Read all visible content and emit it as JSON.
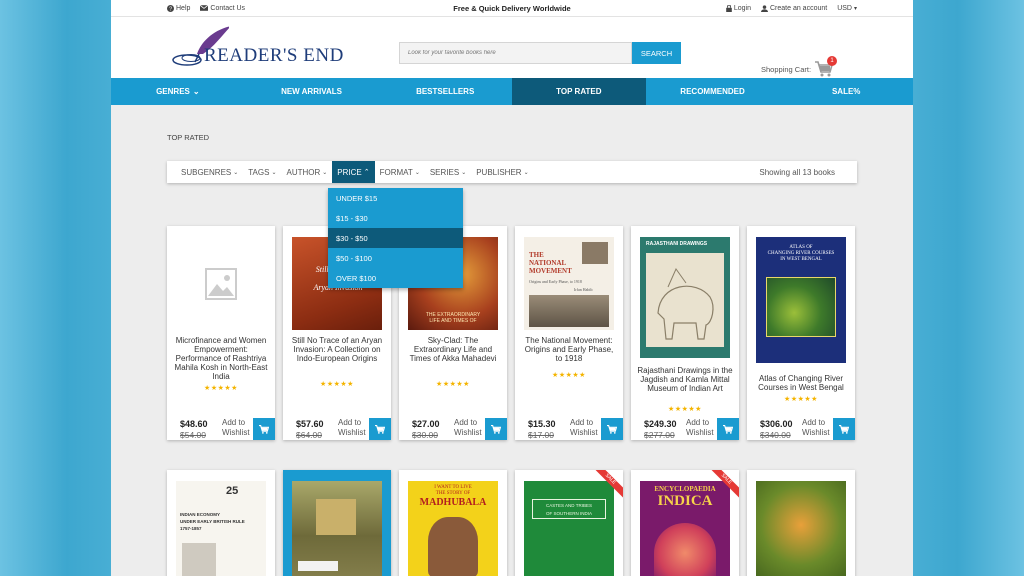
{
  "topbar": {
    "help": "Help",
    "contact": "Contact Us",
    "promo": "Free & Quick Delivery Worldwide",
    "login": "Login",
    "create_account": "Create an account",
    "currency": "USD"
  },
  "header": {
    "logo_text": "READER'S END",
    "search_placeholder": "Look for your favorite books here",
    "search_button": "SEARCH",
    "cart_label": "Shopping Cart:",
    "cart_count": "1"
  },
  "nav": [
    "GENRES",
    "NEW ARRIVALS",
    "BESTSELLERS",
    "TOP RATED",
    "RECOMMENDED",
    "SALE%"
  ],
  "breadcrumb": "TOP RATED",
  "filters": {
    "items": [
      "SUBGENRES",
      "TAGS",
      "AUTHOR",
      "PRICE",
      "FORMAT",
      "SERIES",
      "PUBLISHER"
    ],
    "showing": "Showing all 13 books"
  },
  "price_dropdown": [
    "UNDER $15",
    "$15 - $30",
    "$30 - $50",
    "$50 - $100",
    "OVER $100"
  ],
  "products": [
    {
      "title": "Microfinance and Women Empowerment: Performance of Rashtriya Mahila Kosh in North-East India",
      "price": "$48.60",
      "old_price": "$54.00",
      "wishlist": "Add to Wishlist",
      "rating": 5
    },
    {
      "title": "Still No Trace of an Aryan Invasion: A Collection on Indo-European Origins",
      "price": "$57.60",
      "old_price": "$64.00",
      "wishlist": "Add to Wishlist",
      "rating": 5,
      "cover_lines": [
        "Still No Trace",
        "of an",
        "Aryan Invasion"
      ]
    },
    {
      "title": "Sky-Clad: The Extraordinary Life and Times of Akka Mahadevi",
      "price": "$27.00",
      "old_price": "$30.00",
      "wishlist": "Add to Wishlist",
      "rating": 5,
      "cover_lines": [
        "THE EXTRAORDINARY",
        "LIFE AND TIMES OF"
      ]
    },
    {
      "title": "The National Movement: Origins and Early Phase, to 1918",
      "price": "$15.30",
      "old_price": "$17.00",
      "wishlist": "Add to Wishlist",
      "rating": 5,
      "cover_lines": [
        "THE",
        "NATIONAL",
        "MOVEMENT",
        "Origins and Early Phase, to 1918",
        "Irfan Habib"
      ]
    },
    {
      "title": "Rajasthani Drawings in the Jagdish and Kamla Mittal Museum of Indian Art",
      "price": "$249.30",
      "old_price": "$277.00",
      "wishlist": "Add to Wishlist",
      "rating": 5,
      "cover_lines": [
        "RAJASTHANI DRAWINGS"
      ]
    },
    {
      "title": "Atlas of Changing River Courses in West Bengal",
      "price": "$306.00",
      "old_price": "$340.00",
      "wishlist": "Add to Wishlist",
      "rating": 5,
      "cover_lines": [
        "ATLAS OF",
        "CHANGING RIVER COURSES",
        "IN WEST BENGAL"
      ]
    }
  ],
  "row2_covers": [
    {
      "lines": [
        "25",
        "INDIAN ECONOMY",
        "UNDER EARLY BRITISH RULE",
        "1757-1857"
      ]
    },
    {
      "lines": []
    },
    {
      "lines": [
        "I WANT TO LIVE",
        "THE STORY OF",
        "MADHUBALA"
      ]
    },
    {
      "lines": [
        "CASTES AND TRIBES",
        "OF SOUTHERN INDIA"
      ],
      "sale": "SALE"
    },
    {
      "lines": [
        "ENCYCLOPAEDIA",
        "INDICA"
      ],
      "sale": "SALE"
    },
    {
      "lines": []
    }
  ],
  "colors": {
    "accent": "#1a9bd0",
    "nav_active": "#0d5a7a",
    "sale": "#e53935",
    "star": "#f4b400"
  }
}
